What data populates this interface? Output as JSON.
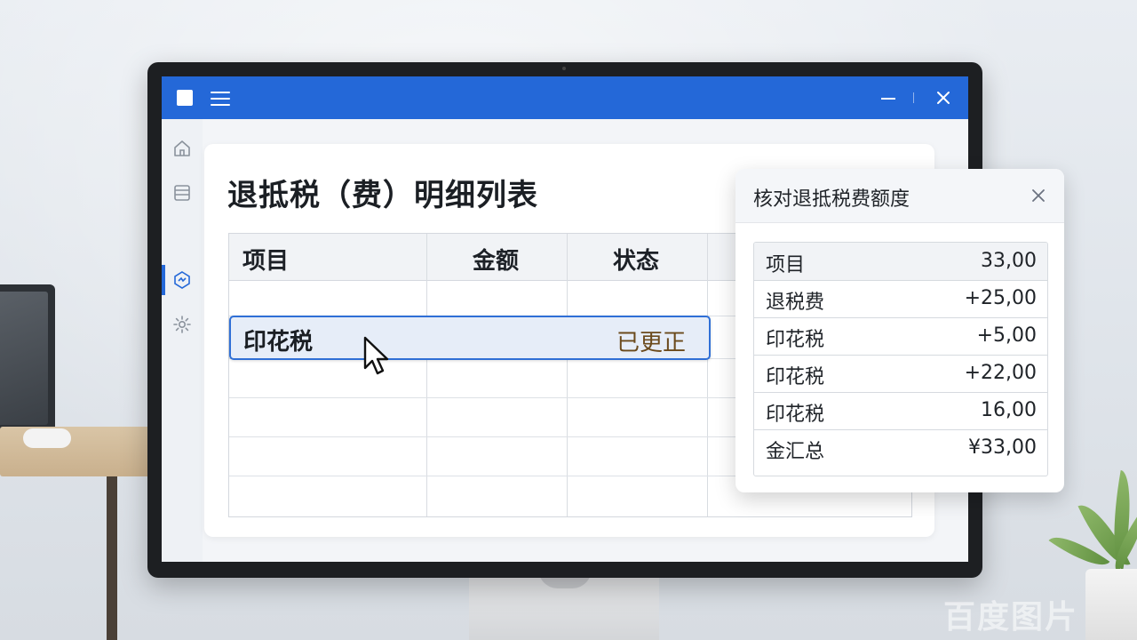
{
  "window": {
    "title_bar_color": "#2468d8"
  },
  "sidebar": {
    "items": [
      {
        "icon": "home-icon"
      },
      {
        "icon": "list-icon"
      },
      {
        "icon": "tax-icon",
        "active": true
      },
      {
        "icon": "gear-icon"
      }
    ]
  },
  "main": {
    "title": "退抵税（费）明细列表",
    "table": {
      "columns": [
        "项目",
        "金额",
        "状态",
        ""
      ],
      "selected_row": {
        "item": "印花税",
        "amount": "",
        "status": "已更正"
      }
    }
  },
  "popup": {
    "title": "核对退抵税费额度",
    "rows": [
      {
        "label": "项目",
        "value": "33,00"
      },
      {
        "label": "退税费",
        "value": "+25,00"
      },
      {
        "label": "印花税",
        "value": "+5,00"
      },
      {
        "label": "印花税",
        "value": "+22,00"
      },
      {
        "label": "印花税",
        "value": "16,00"
      },
      {
        "label": "金汇总",
        "value": "¥33,00"
      }
    ]
  },
  "watermark": "百度图片"
}
